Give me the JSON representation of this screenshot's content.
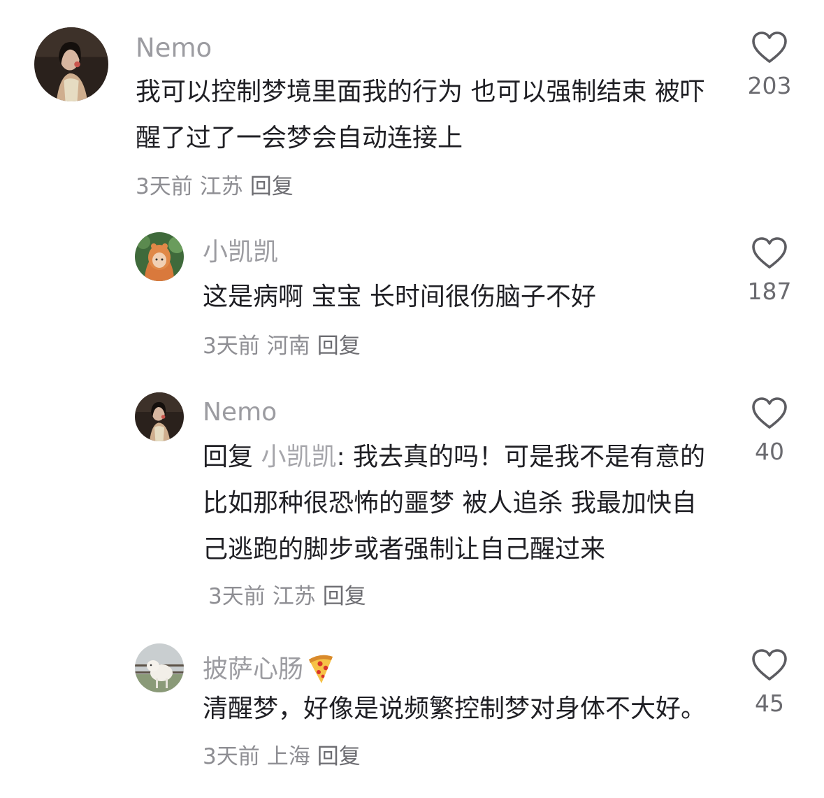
{
  "comments": [
    {
      "author": "Nemo",
      "text": "我可以控制梦境里面我的行为 也可以强制结束 被吓醒了过了一会梦会自动连接上",
      "time": "3天前",
      "location": "江苏",
      "reply_label": "回复",
      "likes": "203",
      "avatar": "woman-photo-avatar"
    },
    {
      "author": "小凯凯",
      "text": "这是病啊 宝宝 长时间很伤脑子不好",
      "time": "3天前",
      "location": "河南",
      "reply_label": "回复",
      "likes": "187",
      "avatar": "child-orange-hood-avatar"
    },
    {
      "author": "Nemo",
      "reply_prefix": "回复",
      "reply_to": "小凯凯",
      "text": ": 我去真的吗！可是我不是有意的 比如那种很恐怖的噩梦 被人追杀 我最加快自己逃跑的脚步或者强制让自己醒过来",
      "time": "3天前",
      "location": "江苏",
      "reply_label": "回复",
      "likes": "40",
      "avatar": "woman-photo-avatar"
    },
    {
      "author": "披萨心肠",
      "author_emoji": "pizza-icon",
      "text": "清醒梦，好像是说频繁控制梦对身体不大好。",
      "time": "3天前",
      "location": "上海",
      "reply_label": "回复",
      "likes": "45",
      "avatar": "lamb-photo-avatar"
    }
  ],
  "colors": {
    "author": "#9c9ca1",
    "text": "#1f1f24",
    "meta": "#8e8e93",
    "like_icon": "#5c5c61"
  }
}
